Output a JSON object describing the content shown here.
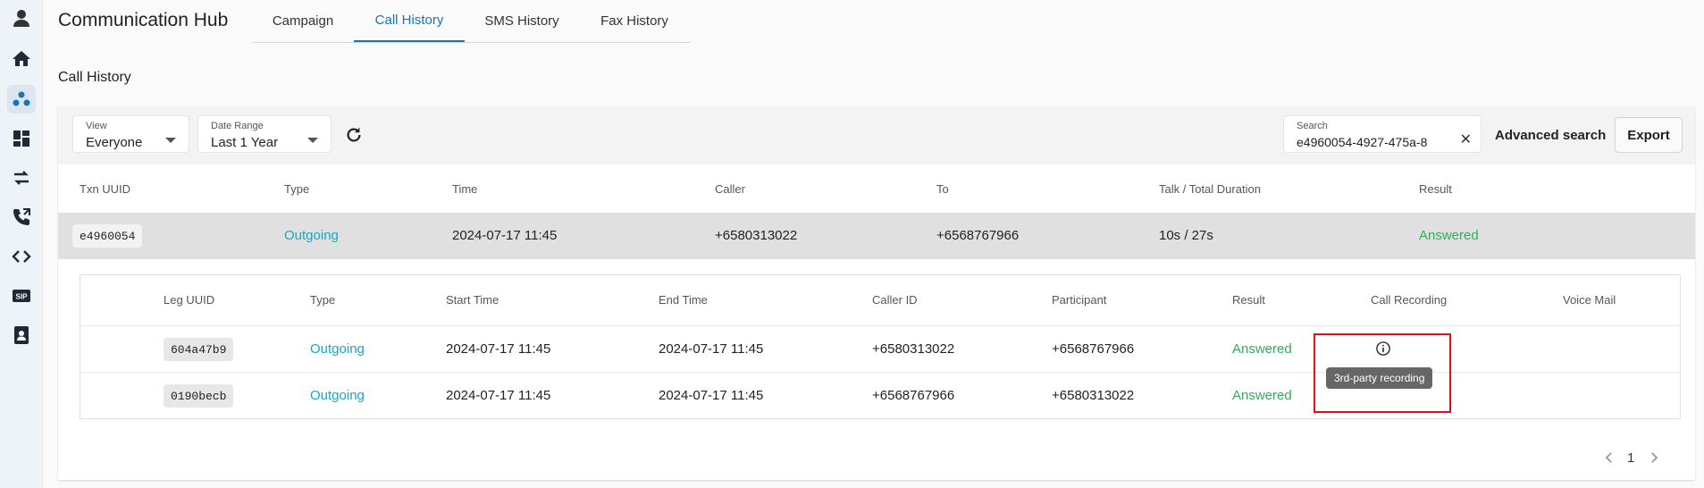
{
  "app": {
    "title": "Communication Hub"
  },
  "sidebar": {
    "items": [
      {
        "name": "profile",
        "icon": "user-avatar-icon"
      },
      {
        "name": "home",
        "icon": "home-icon"
      },
      {
        "name": "communication",
        "icon": "people-icon",
        "active": true
      },
      {
        "name": "dashboard",
        "icon": "dashboard-icon"
      },
      {
        "name": "transfer",
        "icon": "swap-arrows-icon"
      },
      {
        "name": "call-routing",
        "icon": "phone-forward-icon"
      },
      {
        "name": "developer",
        "icon": "code-icon"
      },
      {
        "name": "sip",
        "icon": "sip-icon"
      },
      {
        "name": "contacts",
        "icon": "contact-book-icon"
      }
    ]
  },
  "tabs": [
    {
      "label": "Campaign"
    },
    {
      "label": "Call History",
      "active": true
    },
    {
      "label": "SMS History"
    },
    {
      "label": "Fax History"
    }
  ],
  "section": {
    "title": "Call History"
  },
  "filters": {
    "view": {
      "label": "View",
      "value": "Everyone"
    },
    "date_range": {
      "label": "Date Range",
      "value": "Last 1 Year"
    },
    "search": {
      "label": "Search",
      "value": "e4960054-4927-475a-8"
    },
    "advanced_search": "Advanced search",
    "export": "Export"
  },
  "table": {
    "headers": {
      "txn_uuid": "Txn UUID",
      "type": "Type",
      "time": "Time",
      "caller": "Caller",
      "to": "To",
      "duration": "Talk / Total Duration",
      "result": "Result"
    },
    "row": {
      "txn_uuid": "e4960054",
      "type": "Outgoing",
      "time": "2024-07-17 11:45",
      "caller": "+6580313022",
      "to": "+6568767966",
      "duration": "10s / 27s",
      "result": "Answered"
    }
  },
  "legs": {
    "headers": {
      "leg_uuid": "Leg UUID",
      "type": "Type",
      "start_time": "Start Time",
      "end_time": "End Time",
      "caller_id": "Caller ID",
      "participant": "Participant",
      "result": "Result",
      "call_recording": "Call Recording",
      "voice_mail": "Voice Mail"
    },
    "rows": [
      {
        "leg_uuid": "604a47b9",
        "type": "Outgoing",
        "start_time": "2024-07-17 11:45",
        "end_time": "2024-07-17 11:45",
        "caller_id": "+6580313022",
        "participant": "+6568767966",
        "result": "Answered"
      },
      {
        "leg_uuid": "0190becb",
        "type": "Outgoing",
        "start_time": "2024-07-17 11:45",
        "end_time": "2024-07-17 11:45",
        "caller_id": "+6568767966",
        "participant": "+6580313022",
        "result": "Answered"
      }
    ],
    "recording_tooltip": "3rd-party recording"
  },
  "pagination": {
    "page": "1"
  },
  "colors": {
    "accent": "#1a73b8",
    "link": "#1aa6c8",
    "success": "#2fae5c",
    "highlight_box": "#e0101a"
  }
}
